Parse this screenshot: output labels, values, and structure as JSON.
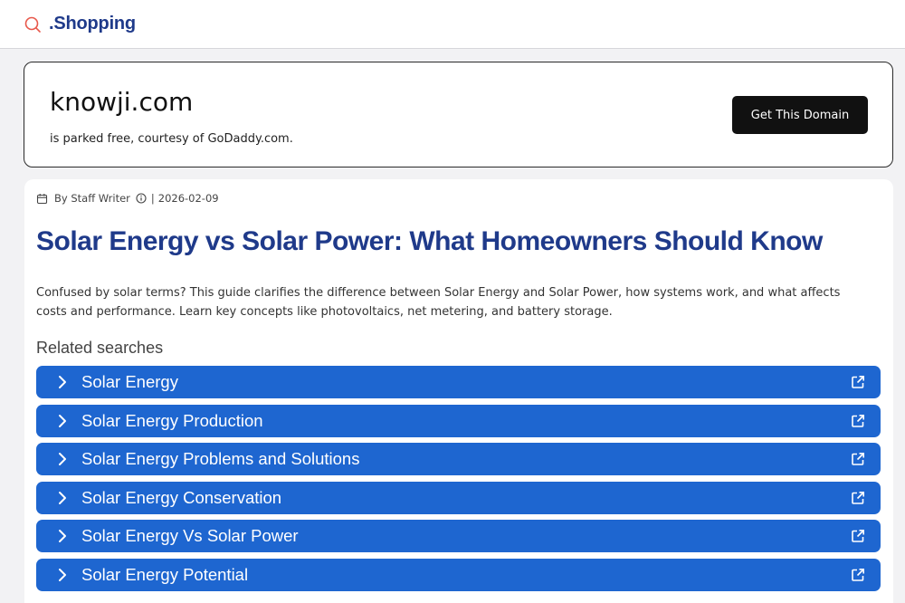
{
  "header": {
    "brand_text": ".Shopping",
    "brand_icon": "search-icon",
    "accent_color": "#e8584b",
    "brand_color": "#1f3a8a"
  },
  "domain_banner": {
    "domain": "knowji.com",
    "subtitle": "is parked free, courtesy of GoDaddy.com.",
    "cta_label": "Get This Domain"
  },
  "article": {
    "meta": {
      "calendar_icon": "calendar-icon",
      "author": "By Staff Writer",
      "info_icon": "info-icon",
      "separator": "|",
      "date": "2026-02-09"
    },
    "title": "Solar Energy vs Solar Power: What Homeowners Should Know",
    "description": "Confused by solar terms? This guide clarifies the difference between Solar Energy and Solar Power, how systems work, and what affects costs and performance. Learn key concepts like photovoltaics, net metering, and battery storage.",
    "related_heading": "Related searches",
    "link_color": "#1e66d0",
    "related": [
      {
        "label": "Solar Energy"
      },
      {
        "label": "Solar Energy Production"
      },
      {
        "label": "Solar Energy Problems and Solutions"
      },
      {
        "label": "Solar Energy Conservation"
      },
      {
        "label": "Solar Energy Vs Solar Power"
      },
      {
        "label": "Solar Energy Potential"
      }
    ]
  }
}
